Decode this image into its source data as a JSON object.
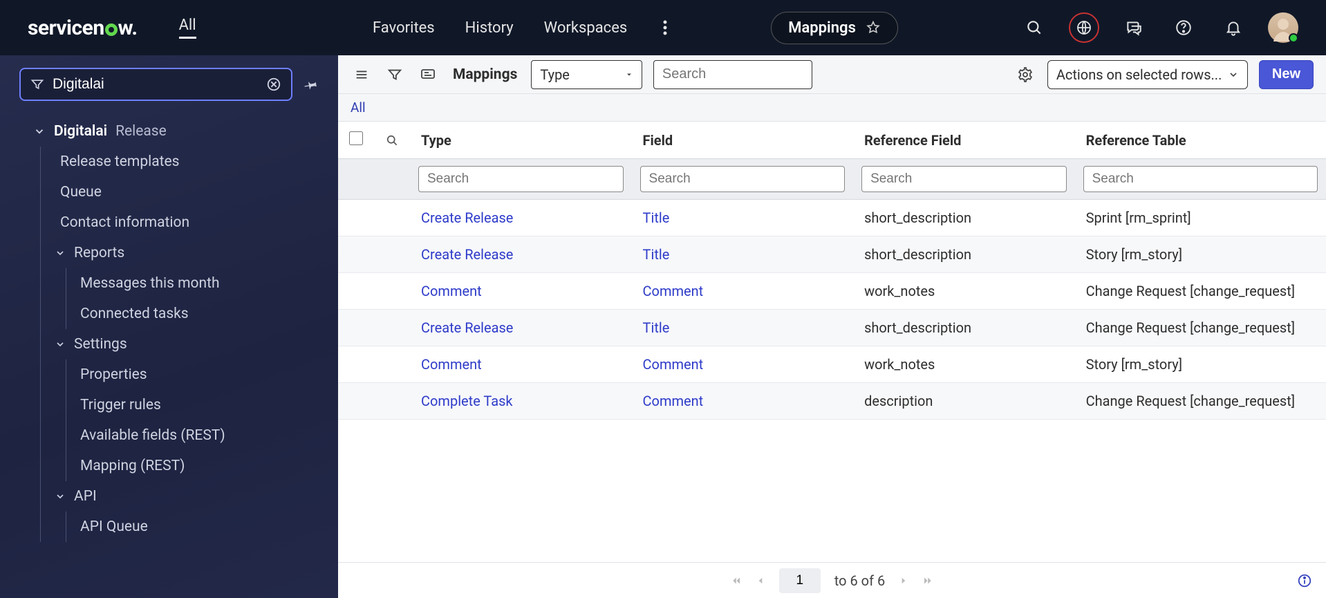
{
  "topbar": {
    "logo_prefix": "servicen",
    "logo_suffix": "w.",
    "all": "All",
    "favorites": "Favorites",
    "history": "History",
    "workspaces": "Workspaces",
    "pill_title": "Mappings"
  },
  "sidebar": {
    "filter_value": "Digitalai",
    "group_title": "Digitalai",
    "group_suffix": "Release",
    "items": {
      "release_templates": "Release templates",
      "queue": "Queue",
      "contact_info": "Contact information",
      "reports": "Reports",
      "messages_month": "Messages this month",
      "connected_tasks": "Connected tasks",
      "settings": "Settings",
      "properties": "Properties",
      "trigger_rules": "Trigger rules",
      "available_fields": "Available fields (REST)",
      "mapping_rest": "Mapping (REST)",
      "api": "API",
      "api_queue": "API Queue"
    }
  },
  "toolbar": {
    "label": "Mappings",
    "type_select": "Type",
    "search_placeholder": "Search",
    "actions_label": "Actions on selected rows...",
    "new_label": "New"
  },
  "breadcrumb": {
    "all": "All"
  },
  "table": {
    "columns": {
      "type": "Type",
      "field": "Field",
      "ref_field": "Reference Field",
      "ref_table": "Reference Table"
    },
    "search_placeholder": "Search",
    "rows": [
      {
        "type": "Create Release",
        "field": "Title",
        "ref_field": "short_description",
        "ref_table": "Sprint [rm_sprint]"
      },
      {
        "type": "Create Release",
        "field": "Title",
        "ref_field": "short_description",
        "ref_table": "Story [rm_story]"
      },
      {
        "type": "Comment",
        "field": "Comment",
        "ref_field": "work_notes",
        "ref_table": "Change Request [change_request]"
      },
      {
        "type": "Create Release",
        "field": "Title",
        "ref_field": "short_description",
        "ref_table": "Change Request [change_request]"
      },
      {
        "type": "Comment",
        "field": "Comment",
        "ref_field": "work_notes",
        "ref_table": "Story [rm_story]"
      },
      {
        "type": "Complete Task",
        "field": "Comment",
        "ref_field": "description",
        "ref_table": "Change Request [change_request]"
      }
    ]
  },
  "footer": {
    "page": "1",
    "range": "to 6 of 6"
  }
}
